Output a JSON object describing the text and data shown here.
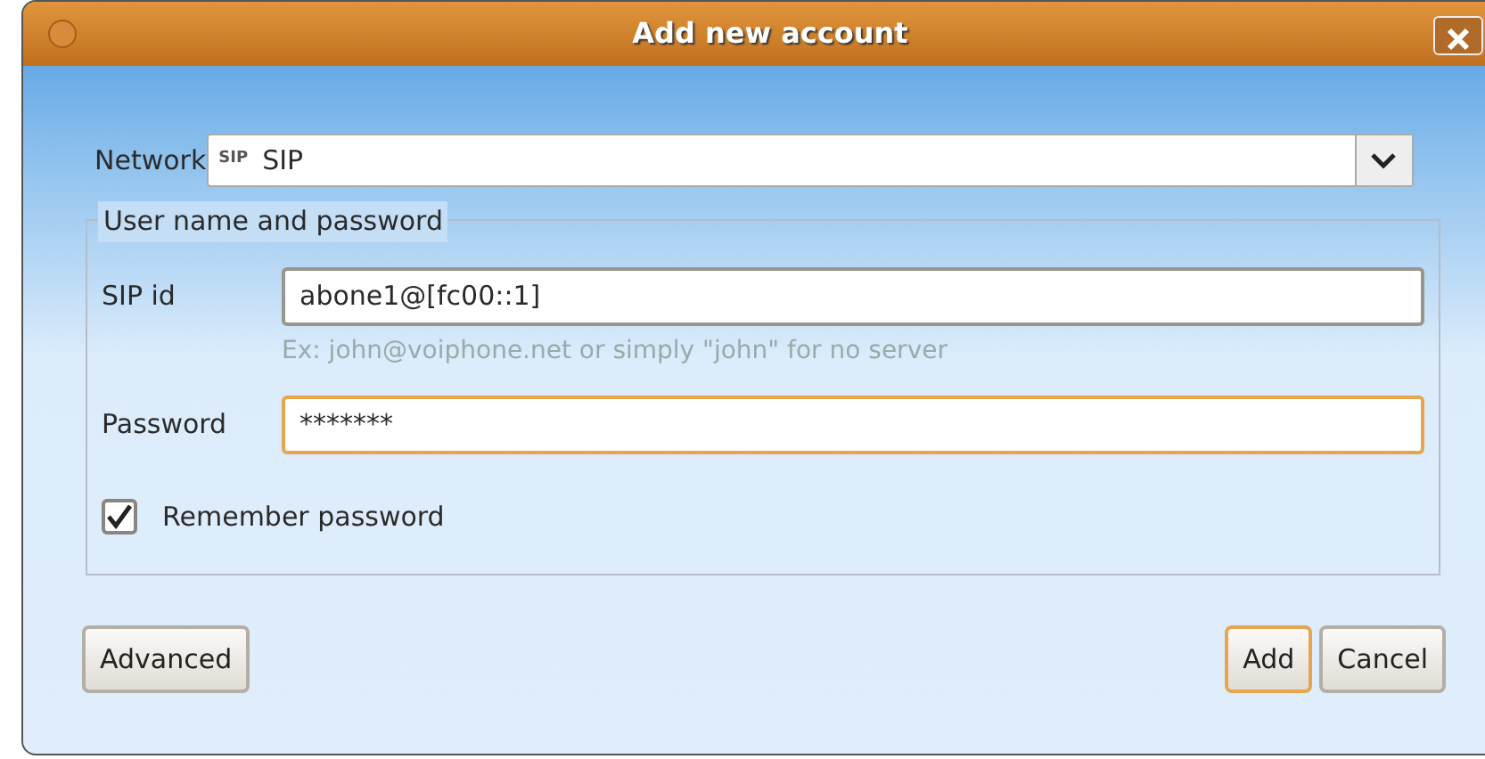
{
  "window": {
    "title": "Add new account"
  },
  "network": {
    "label": "Network",
    "icon_text": "SIP",
    "value": "SIP"
  },
  "group": {
    "legend": "User name and password",
    "fields": [
      {
        "label": "SIP id",
        "value": "abone1@[fc00::1]",
        "hint": "Ex: john@voiphone.net or simply \"john\" for no server",
        "focused": false
      },
      {
        "label": "Password",
        "value": "*******",
        "focused": true
      }
    ],
    "remember": {
      "label": "Remember password",
      "checked": true
    }
  },
  "buttons": [
    {
      "label": "Advanced",
      "focused": false
    },
    {
      "label": "Add",
      "focused": true
    },
    {
      "label": "Cancel",
      "focused": false
    }
  ]
}
